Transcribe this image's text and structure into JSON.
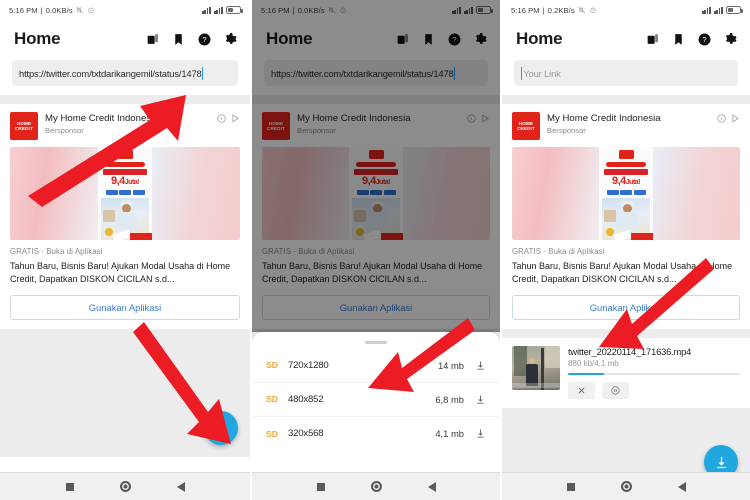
{
  "app": {
    "title": "Home",
    "header_icons": [
      "gallery-icon",
      "bookmark-icon",
      "help-icon",
      "settings-icon"
    ]
  },
  "panels": [
    {
      "id": "panel-paste-link",
      "statusbar": {
        "time": "5:16 PM",
        "separator": "|",
        "netspeed": "0.0KB/s"
      },
      "url_field": {
        "value": "https://twitter.com/txtdarikangemil/status/1478",
        "placeholder": "Your Link",
        "filled": true
      },
      "ad": {
        "logo_line1": "HOME",
        "logo_line2": "CREDIT",
        "advertiser": "My Home Credit Indonesia",
        "sponsored": "Bersponsor",
        "banner_amount": "9,4",
        "banner_amount_unit": "Juta!",
        "price_note": "GRATIS · Buka di Aplikasi",
        "description": "Tahun Baru, Bisnis Baru! Ajukan Modal Usaha di Home Credit, Dapatkan DISKON CICILAN s.d...",
        "cta": "Gunakan Aplikasi"
      },
      "fab": {
        "icon": "download-icon",
        "color": "#21a7e0"
      }
    },
    {
      "id": "panel-quality-sheet",
      "statusbar": {
        "time": "5:16 PM",
        "separator": "|",
        "netspeed": "0.0KB/s"
      },
      "url_field": {
        "value": "https://twitter.com/txtdarikangemil/status/1478",
        "placeholder": "Your Link",
        "filled": true
      },
      "ad": {
        "logo_line1": "HOME",
        "logo_line2": "CREDIT",
        "advertiser": "My Home Credit Indonesia",
        "sponsored": "Bersponsor",
        "banner_amount": "9,4",
        "banner_amount_unit": "Juta!",
        "price_note": "GRATIS · Buka di Aplikasi",
        "description": "Tahun Baru, Bisnis Baru! Ajukan Modal Usaha di Home Credit, Dapatkan DISKON CICILAN s.d...",
        "cta": "Gunakan Aplikasi"
      },
      "sheet": {
        "rows": [
          {
            "quality": "SD",
            "resolution": "720x1280",
            "size": "14 mb"
          },
          {
            "quality": "SD",
            "resolution": "480x852",
            "size": "6,8 mb"
          },
          {
            "quality": "SD",
            "resolution": "320x568",
            "size": "4,1 mb"
          }
        ]
      }
    },
    {
      "id": "panel-downloading",
      "statusbar": {
        "time": "5:16 PM",
        "separator": "|",
        "netspeed": "0.2KB/s"
      },
      "url_field": {
        "value": "",
        "placeholder": "Your Link",
        "filled": false
      },
      "ad": {
        "logo_line1": "HOME",
        "logo_line2": "CREDIT",
        "advertiser": "My Home Credit Indonesia",
        "sponsored": "Bersponsor",
        "banner_amount": "9,4",
        "banner_amount_unit": "Juta!",
        "price_note": "GRATIS · Buka di Aplikasi",
        "description": "Tahun Baru, Bisnis Baru! Ajukan Modal Usaha di Home Credit, Dapatkan DISKON CICILAN s.d...",
        "cta": "Gunakan Aplikasi"
      },
      "download": {
        "filename": "twitter_20220114_171636.mp4",
        "progress_text": "880 kb/4,1 mb",
        "progress_percent": 21,
        "cancel_icon": "close-icon",
        "pause_icon": "pause-icon"
      },
      "fab": {
        "icon": "download-icon",
        "color": "#21a7e0"
      }
    }
  ],
  "navbar": {
    "recents": "square-icon",
    "home": "circle-icon",
    "back": "triangle-icon"
  },
  "annotations": {
    "arrow_color": "#ec1c24",
    "count": 4
  }
}
